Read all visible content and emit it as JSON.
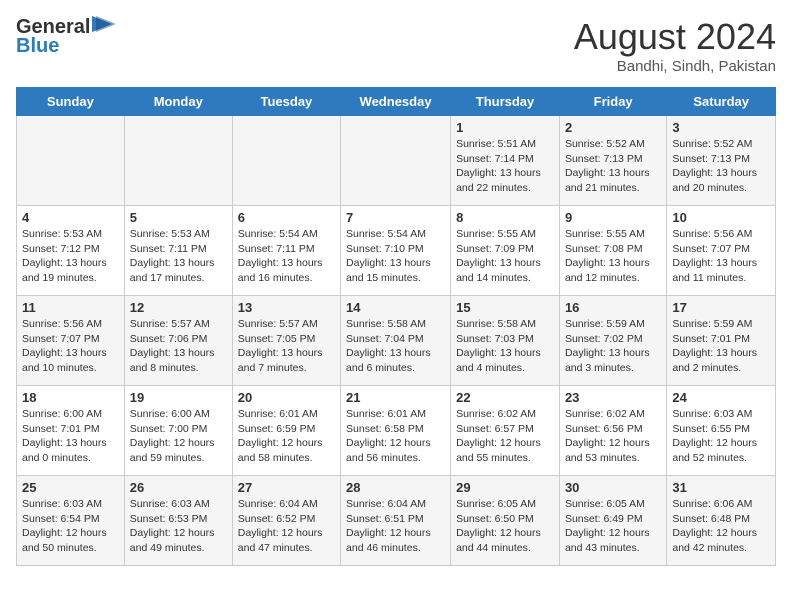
{
  "header": {
    "logo_general": "General",
    "logo_blue": "Blue",
    "month_year": "August 2024",
    "location": "Bandhi, Sindh, Pakistan"
  },
  "weekdays": [
    "Sunday",
    "Monday",
    "Tuesday",
    "Wednesday",
    "Thursday",
    "Friday",
    "Saturday"
  ],
  "weeks": [
    [
      {
        "day": "",
        "info": ""
      },
      {
        "day": "",
        "info": ""
      },
      {
        "day": "",
        "info": ""
      },
      {
        "day": "",
        "info": ""
      },
      {
        "day": "1",
        "info": "Sunrise: 5:51 AM\nSunset: 7:14 PM\nDaylight: 13 hours\nand 22 minutes."
      },
      {
        "day": "2",
        "info": "Sunrise: 5:52 AM\nSunset: 7:13 PM\nDaylight: 13 hours\nand 21 minutes."
      },
      {
        "day": "3",
        "info": "Sunrise: 5:52 AM\nSunset: 7:13 PM\nDaylight: 13 hours\nand 20 minutes."
      }
    ],
    [
      {
        "day": "4",
        "info": "Sunrise: 5:53 AM\nSunset: 7:12 PM\nDaylight: 13 hours\nand 19 minutes."
      },
      {
        "day": "5",
        "info": "Sunrise: 5:53 AM\nSunset: 7:11 PM\nDaylight: 13 hours\nand 17 minutes."
      },
      {
        "day": "6",
        "info": "Sunrise: 5:54 AM\nSunset: 7:11 PM\nDaylight: 13 hours\nand 16 minutes."
      },
      {
        "day": "7",
        "info": "Sunrise: 5:54 AM\nSunset: 7:10 PM\nDaylight: 13 hours\nand 15 minutes."
      },
      {
        "day": "8",
        "info": "Sunrise: 5:55 AM\nSunset: 7:09 PM\nDaylight: 13 hours\nand 14 minutes."
      },
      {
        "day": "9",
        "info": "Sunrise: 5:55 AM\nSunset: 7:08 PM\nDaylight: 13 hours\nand 12 minutes."
      },
      {
        "day": "10",
        "info": "Sunrise: 5:56 AM\nSunset: 7:07 PM\nDaylight: 13 hours\nand 11 minutes."
      }
    ],
    [
      {
        "day": "11",
        "info": "Sunrise: 5:56 AM\nSunset: 7:07 PM\nDaylight: 13 hours\nand 10 minutes."
      },
      {
        "day": "12",
        "info": "Sunrise: 5:57 AM\nSunset: 7:06 PM\nDaylight: 13 hours\nand 8 minutes."
      },
      {
        "day": "13",
        "info": "Sunrise: 5:57 AM\nSunset: 7:05 PM\nDaylight: 13 hours\nand 7 minutes."
      },
      {
        "day": "14",
        "info": "Sunrise: 5:58 AM\nSunset: 7:04 PM\nDaylight: 13 hours\nand 6 minutes."
      },
      {
        "day": "15",
        "info": "Sunrise: 5:58 AM\nSunset: 7:03 PM\nDaylight: 13 hours\nand 4 minutes."
      },
      {
        "day": "16",
        "info": "Sunrise: 5:59 AM\nSunset: 7:02 PM\nDaylight: 13 hours\nand 3 minutes."
      },
      {
        "day": "17",
        "info": "Sunrise: 5:59 AM\nSunset: 7:01 PM\nDaylight: 13 hours\nand 2 minutes."
      }
    ],
    [
      {
        "day": "18",
        "info": "Sunrise: 6:00 AM\nSunset: 7:01 PM\nDaylight: 13 hours\nand 0 minutes."
      },
      {
        "day": "19",
        "info": "Sunrise: 6:00 AM\nSunset: 7:00 PM\nDaylight: 12 hours\nand 59 minutes."
      },
      {
        "day": "20",
        "info": "Sunrise: 6:01 AM\nSunset: 6:59 PM\nDaylight: 12 hours\nand 58 minutes."
      },
      {
        "day": "21",
        "info": "Sunrise: 6:01 AM\nSunset: 6:58 PM\nDaylight: 12 hours\nand 56 minutes."
      },
      {
        "day": "22",
        "info": "Sunrise: 6:02 AM\nSunset: 6:57 PM\nDaylight: 12 hours\nand 55 minutes."
      },
      {
        "day": "23",
        "info": "Sunrise: 6:02 AM\nSunset: 6:56 PM\nDaylight: 12 hours\nand 53 minutes."
      },
      {
        "day": "24",
        "info": "Sunrise: 6:03 AM\nSunset: 6:55 PM\nDaylight: 12 hours\nand 52 minutes."
      }
    ],
    [
      {
        "day": "25",
        "info": "Sunrise: 6:03 AM\nSunset: 6:54 PM\nDaylight: 12 hours\nand 50 minutes."
      },
      {
        "day": "26",
        "info": "Sunrise: 6:03 AM\nSunset: 6:53 PM\nDaylight: 12 hours\nand 49 minutes."
      },
      {
        "day": "27",
        "info": "Sunrise: 6:04 AM\nSunset: 6:52 PM\nDaylight: 12 hours\nand 47 minutes."
      },
      {
        "day": "28",
        "info": "Sunrise: 6:04 AM\nSunset: 6:51 PM\nDaylight: 12 hours\nand 46 minutes."
      },
      {
        "day": "29",
        "info": "Sunrise: 6:05 AM\nSunset: 6:50 PM\nDaylight: 12 hours\nand 44 minutes."
      },
      {
        "day": "30",
        "info": "Sunrise: 6:05 AM\nSunset: 6:49 PM\nDaylight: 12 hours\nand 43 minutes."
      },
      {
        "day": "31",
        "info": "Sunrise: 6:06 AM\nSunset: 6:48 PM\nDaylight: 12 hours\nand 42 minutes."
      }
    ]
  ]
}
